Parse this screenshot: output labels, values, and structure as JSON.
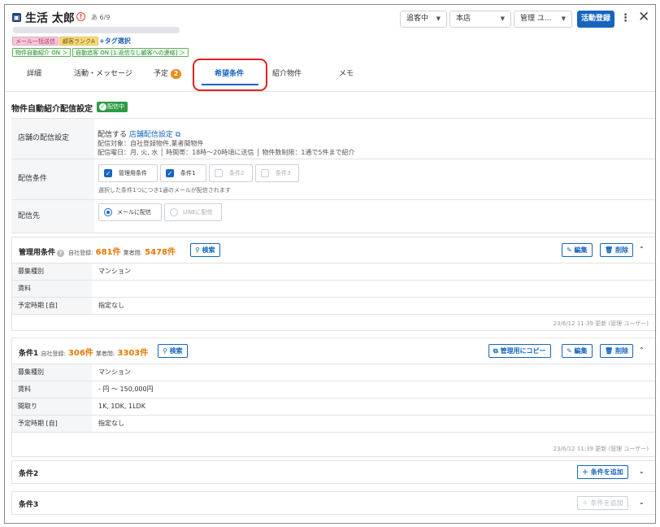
{
  "header": {
    "customer_icon": "▣",
    "name": "生活 太郎",
    "warn_icon": "!",
    "count": "あ 6/9",
    "tags": [
      "メール一括送信",
      "顧客ランクA"
    ],
    "add_tag": "+タグ選択",
    "auto_tags": [
      "物件自動紹介 ON ＞",
      "自動追客 ON [1.返信なし顧客への連絡] ＞"
    ],
    "status_select": "追客中",
    "store_select": "本店",
    "manager_select": "管理 ユ...",
    "register_button": "活動登録",
    "kebab": "⋮",
    "close": "✕"
  },
  "tabs": [
    {
      "label": "詳細"
    },
    {
      "label": "活動・メッセージ"
    },
    {
      "label": "予定",
      "badge": "2"
    },
    {
      "label": "希望条件"
    },
    {
      "label": "紹介物件"
    },
    {
      "label": "メモ"
    }
  ],
  "auto_setting": {
    "title": "物件自動紹介配信設定",
    "status": "配信中",
    "rows": {
      "store_label": "店舗の配信設定",
      "store_value_prefix": "配信する",
      "store_link": "店舗配信設定",
      "store_line1": "配信対象：自社登録物件,業者間物件",
      "store_line2": "配信曜日：月, 火, 水 │ 時間帯：18時〜20時頃に送信 │ 物件数制限：1通で5件まで紹介",
      "cond_label": "配信条件",
      "checks": [
        {
          "label": "管理用条件",
          "checked": true
        },
        {
          "label": "条件1",
          "checked": true
        },
        {
          "label": "条件2",
          "checked": false
        },
        {
          "label": "条件3",
          "checked": false
        }
      ],
      "cond_note": "選択した条件1つにつき1通のメールが配信されます",
      "dest_label": "配信先",
      "radios": [
        {
          "label": "メールに配信",
          "selected": true
        },
        {
          "label": "LINEに配信",
          "selected": false
        }
      ]
    }
  },
  "manage_condition": {
    "title": "管理用条件",
    "help": "?",
    "own_label": "自社登録:",
    "own_count": "681件",
    "broker_label": "業者間:",
    "broker_count": "5478件",
    "search": "検索",
    "edit": "編集",
    "delete": "削除",
    "rows": [
      {
        "label": "募集種別",
        "value": "マンション"
      },
      {
        "label": "賃料",
        "value": ""
      },
      {
        "label": "予定時期 [自]",
        "value": "指定なし"
      }
    ],
    "updated": "23/6/12 11:39 更新 (管理 ユーザー)"
  },
  "condition1": {
    "title": "条件1",
    "own_label": "自社登録:",
    "own_count": "306件",
    "broker_label": "業者間:",
    "broker_count": "3303件",
    "search": "検索",
    "copy": "管理用にコピー",
    "edit": "編集",
    "delete": "削除",
    "rows": [
      {
        "label": "募集種別",
        "value": "マンション"
      },
      {
        "label": "賃料",
        "value": "- 円 〜 150,000円"
      },
      {
        "label": "間取り",
        "value": "1K, 1DK, 1LDK"
      },
      {
        "label": "予定時期 [自]",
        "value": "指定なし"
      }
    ],
    "updated": "23/6/12 11:39 更新 (管理 ユーザー)"
  },
  "condition2": {
    "title": "条件2",
    "add": "条件を追加"
  },
  "condition3": {
    "title": "条件3",
    "add": "条件を追加"
  },
  "colors": {
    "accent": "#1565c0",
    "orange": "#e87700",
    "green": "#2e9b45",
    "highlight": "#e02020"
  }
}
